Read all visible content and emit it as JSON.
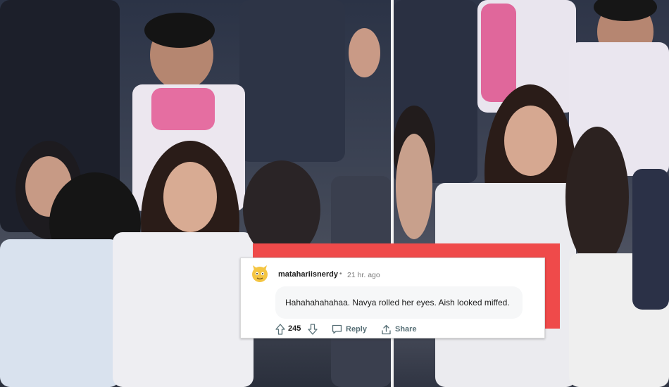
{
  "comment": {
    "username": "matahariisnerdy",
    "separator": "•",
    "timestamp": "21 hr. ago",
    "body": "Hahahahahahaa. Navya rolled her eyes. Aish looked miffed.",
    "vote_count": "245",
    "reply_label": "Reply",
    "share_label": "Share"
  },
  "colors": {
    "accent": "#ef4a4a",
    "card": "#ffffff",
    "bubble": "#f6f7f8",
    "action": "#576f76"
  },
  "icons": [
    "avatar-icon",
    "upvote-icon",
    "downvote-icon",
    "reply-icon",
    "share-icon"
  ]
}
